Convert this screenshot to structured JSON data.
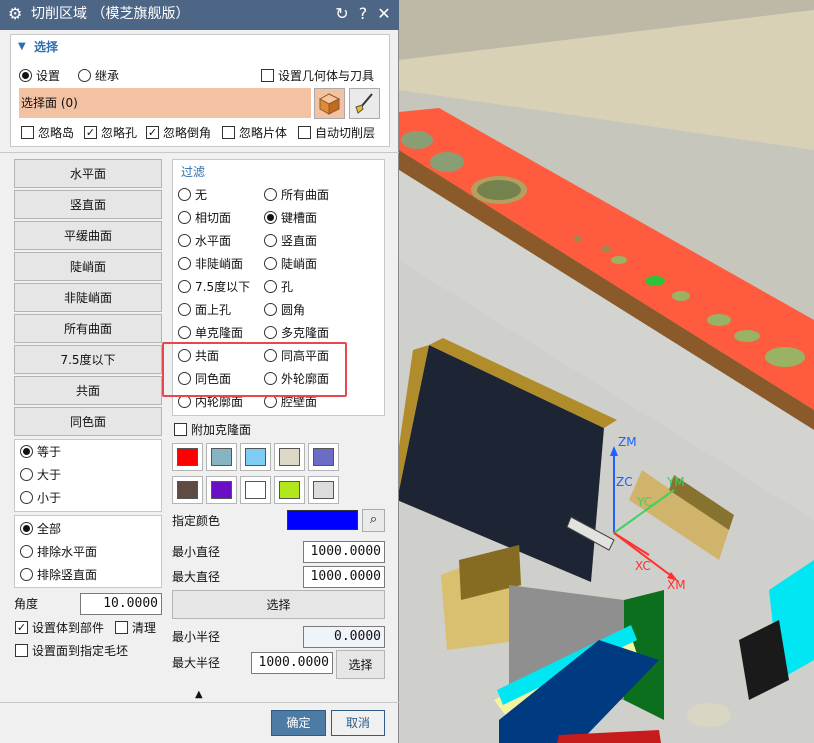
{
  "window": {
    "title": "切削区域  （模芝旗舰版）",
    "icons": [
      "gear-icon",
      "reset-icon",
      "help-icon",
      "close-icon"
    ]
  },
  "section": {
    "title": "选择"
  },
  "mode": {
    "options": [
      "设置",
      "继承"
    ],
    "selected": "设置"
  },
  "set_geometry_tool": {
    "label": "设置几何体与刀具",
    "checked": false
  },
  "select_face": {
    "label": "选择面 (0)"
  },
  "ignore_options": [
    {
      "label": "忽略岛",
      "checked": false
    },
    {
      "label": "忽略孔",
      "checked": true
    },
    {
      "label": "忽略倒角",
      "checked": true
    },
    {
      "label": "忽略片体",
      "checked": false
    },
    {
      "label": "自动切削层",
      "checked": false
    }
  ],
  "face_buttons": [
    "水平面",
    "竖直面",
    "平缓曲面",
    "陡峭面",
    "非陡峭面",
    "所有曲面",
    "7.5度以下",
    "共面",
    "同色面"
  ],
  "compare": {
    "options": [
      "等于",
      "大于",
      "小于"
    ],
    "selected": "等于"
  },
  "scope": {
    "options": [
      "全部",
      "排除水平面",
      "排除竖直面"
    ],
    "selected": "全部"
  },
  "angle": {
    "label": "角度",
    "value": "10.0000"
  },
  "set_to_part": {
    "label": "设置体到部件",
    "checked": true
  },
  "clear": {
    "label": "清理",
    "checked": false
  },
  "set_to_blank": {
    "label": "设置面到指定毛坯",
    "checked": false
  },
  "filter": {
    "title": "过滤",
    "rows": [
      [
        "无",
        "所有曲面"
      ],
      [
        "相切面",
        "键槽面"
      ],
      [
        "水平面",
        "竖直面"
      ],
      [
        "非陡峭面",
        "陡峭面"
      ],
      [
        "7.5度以下",
        "孔"
      ],
      [
        "面上孔",
        "圆角"
      ],
      [
        "单克隆面",
        "多克隆面"
      ],
      [
        "共面",
        "同高平面"
      ],
      [
        "同色面",
        "外轮廓面"
      ],
      [
        "内轮廓面",
        "腔壁面"
      ]
    ],
    "selected": "键槽面"
  },
  "add_clone": {
    "label": "附加克隆面",
    "checked": false
  },
  "palette": {
    "colors": [
      "#ff0000",
      "#86b4c2",
      "#7ecbf4",
      "#ddd8c6",
      "#6c6cc6",
      "#5e4c42",
      "#6a0fc6",
      "#ffffff",
      "#b0e81c",
      "#dcdcdc"
    ]
  },
  "specified_color": {
    "label": "指定颜色",
    "value": "#0000ff",
    "icon": "binoculars-icon"
  },
  "min_diameter": {
    "label": "最小直径",
    "value": "1000.0000"
  },
  "max_diameter": {
    "label": "最大直径",
    "value": "1000.0000"
  },
  "select_btn": "选择",
  "min_radius": {
    "label": "最小半径",
    "value": "0.0000"
  },
  "max_radius": {
    "label": "最大半径",
    "value": "1000.0000"
  },
  "select_btn2": "选择",
  "ok": "确定",
  "cancel": "取消",
  "axes": {
    "zm": "ZM",
    "zc": "ZC",
    "yc": "YC",
    "ym": "YM",
    "xc": "XC",
    "xm": "XM"
  },
  "colors": {
    "title_bar": "#4d6685",
    "accent": "#2f6fb0",
    "highlight": "#e8484d",
    "selected_face": "#f2c2a2"
  }
}
